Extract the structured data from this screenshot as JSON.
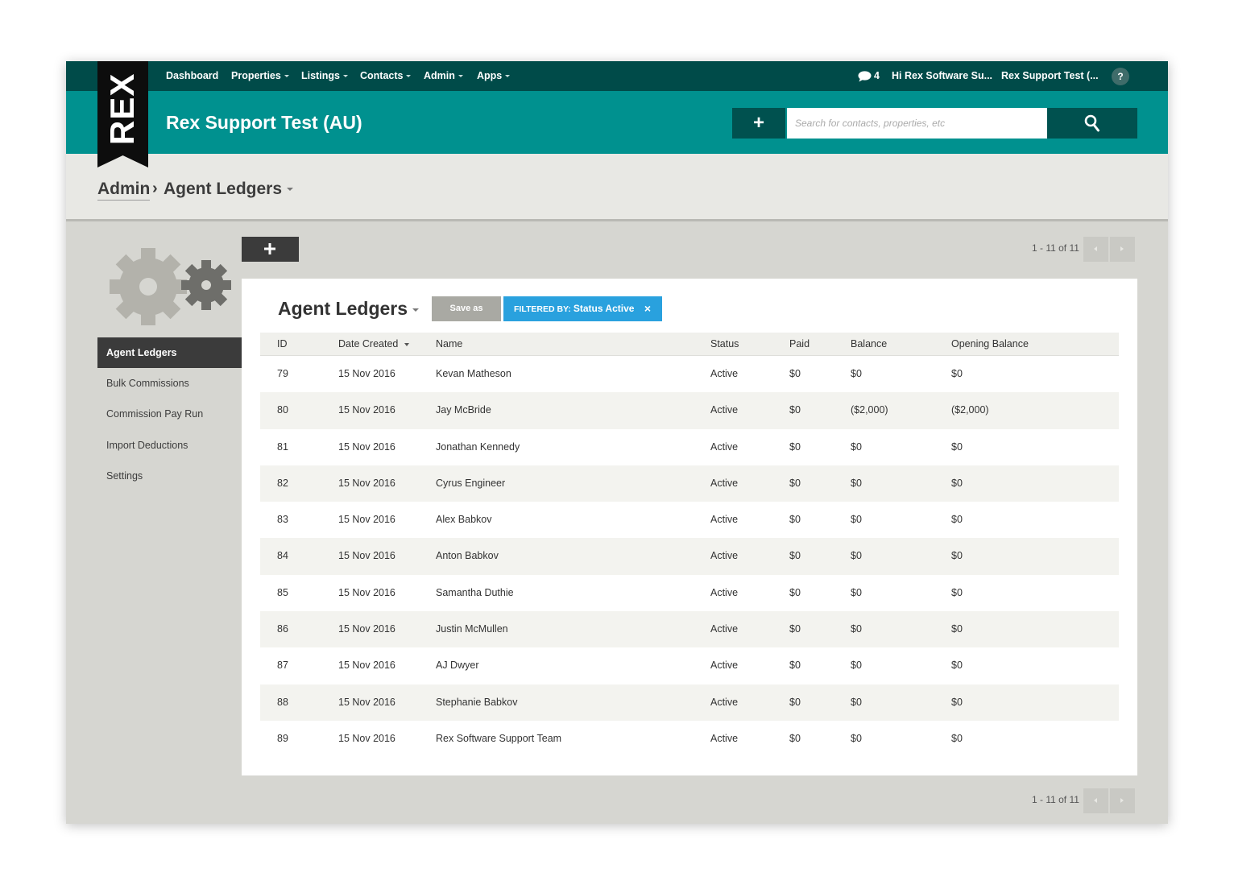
{
  "topnav": {
    "items": [
      {
        "label": "Dashboard",
        "has_caret": false
      },
      {
        "label": "Properties",
        "has_caret": true
      },
      {
        "label": "Listings",
        "has_caret": true
      },
      {
        "label": "Contacts",
        "has_caret": true
      },
      {
        "label": "Admin",
        "has_caret": true
      },
      {
        "label": "Apps",
        "has_caret": true
      }
    ],
    "chat_count": "4",
    "user_greeting": "Hi Rex Software Su...",
    "account_name": "Rex Support Test (...",
    "help_label": "?"
  },
  "logo": {
    "text": "REX"
  },
  "header": {
    "title": "Rex Support Test (AU)",
    "add_label": "+",
    "search_placeholder": "Search for contacts, properties, etc"
  },
  "breadcrumb": {
    "root": "Admin",
    "separator": "›",
    "current": "Agent Ledgers"
  },
  "sidebar": {
    "items": [
      {
        "label": "Agent Ledgers",
        "active": true
      },
      {
        "label": "Bulk Commissions",
        "active": false
      },
      {
        "label": "Commission Pay Run",
        "active": false
      },
      {
        "label": "Import Deductions",
        "active": false
      },
      {
        "label": "Settings",
        "active": false
      }
    ]
  },
  "pager": {
    "text": "1 - 11 of 11"
  },
  "panel": {
    "title": "Agent Ledgers",
    "save_label": "Save as",
    "filter_label": "FILTERED BY:",
    "filter_value": "Status Active",
    "filter_close": "×"
  },
  "table": {
    "columns": [
      "ID",
      "Date Created",
      "Name",
      "Status",
      "Paid",
      "Balance",
      "Opening Balance"
    ],
    "rows": [
      [
        "79",
        "15 Nov 2016",
        "Kevan Matheson",
        "Active",
        "$0",
        "$0",
        "$0"
      ],
      [
        "80",
        "15 Nov 2016",
        "Jay McBride",
        "Active",
        "$0",
        "($2,000)",
        "($2,000)"
      ],
      [
        "81",
        "15 Nov 2016",
        "Jonathan Kennedy",
        "Active",
        "$0",
        "$0",
        "$0"
      ],
      [
        "82",
        "15 Nov 2016",
        "Cyrus Engineer",
        "Active",
        "$0",
        "$0",
        "$0"
      ],
      [
        "83",
        "15 Nov 2016",
        "Alex Babkov",
        "Active",
        "$0",
        "$0",
        "$0"
      ],
      [
        "84",
        "15 Nov 2016",
        "Anton Babkov",
        "Active",
        "$0",
        "$0",
        "$0"
      ],
      [
        "85",
        "15 Nov 2016",
        "Samantha Duthie",
        "Active",
        "$0",
        "$0",
        "$0"
      ],
      [
        "86",
        "15 Nov 2016",
        "Justin McMullen",
        "Active",
        "$0",
        "$0",
        "$0"
      ],
      [
        "87",
        "15 Nov 2016",
        "AJ Dwyer",
        "Active",
        "$0",
        "$0",
        "$0"
      ],
      [
        "88",
        "15 Nov 2016",
        "Stephanie Babkov",
        "Active",
        "$0",
        "$0",
        "$0"
      ],
      [
        "89",
        "15 Nov 2016",
        "Rex Software Support Team",
        "Active",
        "$0",
        "$0",
        "$0"
      ]
    ]
  },
  "colors": {
    "nav_dark": "#004b49",
    "brand_teal": "#00918f",
    "button_dark_teal": "#00514f",
    "filter_blue": "#29a1de",
    "sidebar_active": "#3b3b3b"
  },
  "icons": {
    "chat": "chat-bubble-icon",
    "search": "magnifier-icon",
    "gears": "gears-icon",
    "plus": "plus-icon"
  }
}
